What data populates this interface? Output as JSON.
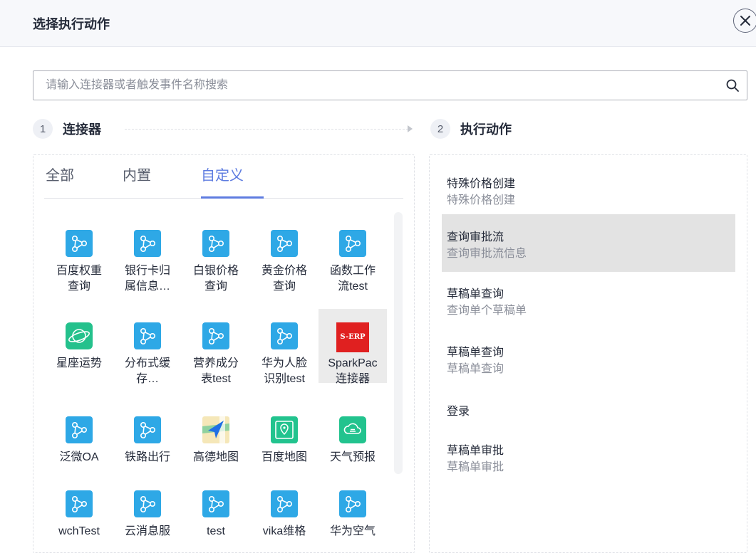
{
  "dialog": {
    "title": "选择执行动作"
  },
  "search": {
    "placeholder": "请输入连接器或者触发事件名称搜索"
  },
  "steps": [
    {
      "num": "1",
      "label": "连接器"
    },
    {
      "num": "2",
      "label": "执行动作"
    }
  ],
  "tabs": [
    {
      "label": "全部"
    },
    {
      "label": "内置"
    },
    {
      "label": "自定义",
      "active": true
    }
  ],
  "connectors": [
    {
      "line1": "百度权重",
      "line2": "查询",
      "icon": "flow-icon"
    },
    {
      "line1": "银行卡归",
      "line2": "属信息…",
      "icon": "flow-icon"
    },
    {
      "line1": "白银价格",
      "line2": "查询",
      "icon": "flow-icon"
    },
    {
      "line1": "黄金价格",
      "line2": "查询",
      "icon": "flow-icon"
    },
    {
      "line1": "函数工作",
      "line2": "流test",
      "icon": "flow-icon"
    },
    {
      "line1": "星座运势",
      "line2": "",
      "icon": "planet-icon"
    },
    {
      "line1": "分布式缓",
      "line2": "存…",
      "icon": "flow-icon"
    },
    {
      "line1": "营养成分",
      "line2": "表test",
      "icon": "flow-icon"
    },
    {
      "line1": "华为人脸",
      "line2": "识别test",
      "icon": "flow-icon"
    },
    {
      "line1": "SparkPac",
      "line2": "连接器",
      "icon": "s-erp-logo",
      "logo_text": "S-ERP",
      "selected": true
    },
    {
      "line1": "泛微OA",
      "line2": "",
      "icon": "flow-icon"
    },
    {
      "line1": "铁路出行",
      "line2": "",
      "icon": "flow-icon"
    },
    {
      "line1": "高德地图",
      "line2": "",
      "icon": "map-icon"
    },
    {
      "line1": "百度地图",
      "line2": "",
      "icon": "map-pin-icon"
    },
    {
      "line1": "天气预报",
      "line2": "",
      "icon": "weather-cloud-icon"
    },
    {
      "line1": "wchTest",
      "line2": "",
      "icon": "flow-icon"
    },
    {
      "line1": "云消息服",
      "line2": "",
      "icon": "flow-icon"
    },
    {
      "line1": "test",
      "line2": "",
      "icon": "flow-icon"
    },
    {
      "line1": "vika维格",
      "line2": "",
      "icon": "flow-icon"
    },
    {
      "line1": "华为空气",
      "line2": "",
      "icon": "flow-icon"
    }
  ],
  "actions": [
    {
      "title": "特殊价格创建",
      "desc": "特殊价格创建"
    },
    {
      "title": "查询审批流",
      "desc": "查询审批流信息",
      "active": true
    },
    {
      "title": "草稿单查询",
      "desc": "查询单个草稿单"
    },
    {
      "title": "草稿单查询",
      "desc": "草稿单查询"
    },
    {
      "title": "登录",
      "desc": ""
    },
    {
      "title": "草稿单审批",
      "desc": "草稿单审批"
    }
  ],
  "colors": {
    "accent": "#5e7ce0",
    "connector_icon_bg": "#2ea8e6",
    "planet_icon_bg": "#24c18c",
    "weather_icon_bg": "#22c38e",
    "s_erp_bg": "#e02020",
    "selected_row_bg": "#e3e3e3"
  }
}
